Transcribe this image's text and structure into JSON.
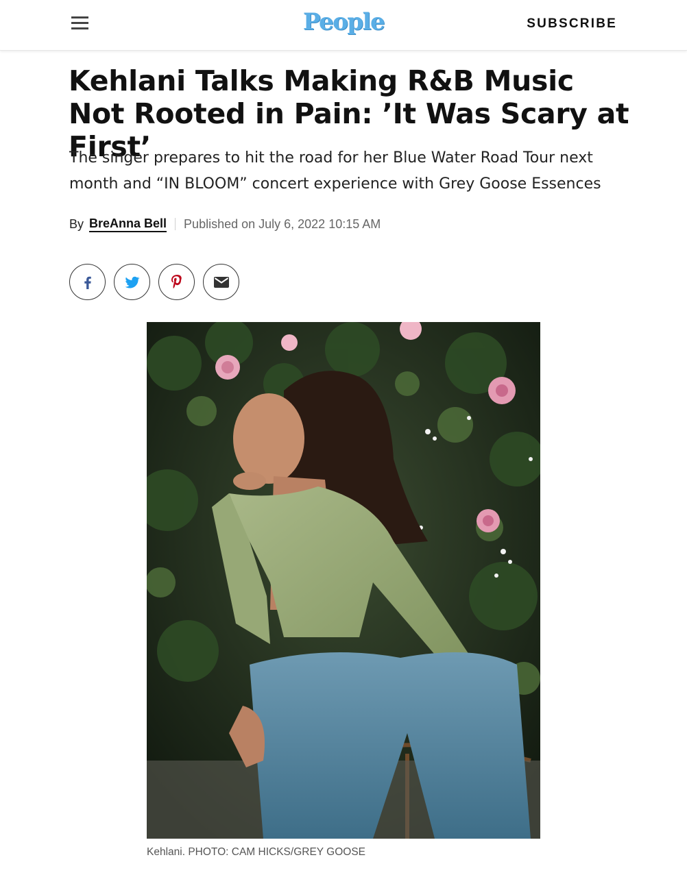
{
  "header": {
    "brand": "People",
    "subscribe_label": "SUBSCRIBE",
    "menu_icon": "hamburger-menu-icon"
  },
  "article": {
    "headline": "Kehlani Talks Making R&B Music Not Rooted in Pain: ’It Was Scary at First’",
    "dek": "The singer prepares to hit the road for her Blue Water Road Tour next month and “IN BLOOM” concert experience with Grey Goose Essences",
    "byline_prefix": "By",
    "author": "BreAnna Bell",
    "published": "Published on July 6, 2022 10:15 AM"
  },
  "share": {
    "buttons": [
      {
        "icon": "facebook-icon",
        "color": "#3b5998"
      },
      {
        "icon": "twitter-icon",
        "color": "#1da1f2"
      },
      {
        "icon": "pinterest-icon",
        "color": "#bd081c"
      },
      {
        "icon": "email-icon",
        "color": "#333333"
      }
    ]
  },
  "image": {
    "caption": "Kehlani. PHOTO: CAM HICKS/GREY GOOSE"
  }
}
